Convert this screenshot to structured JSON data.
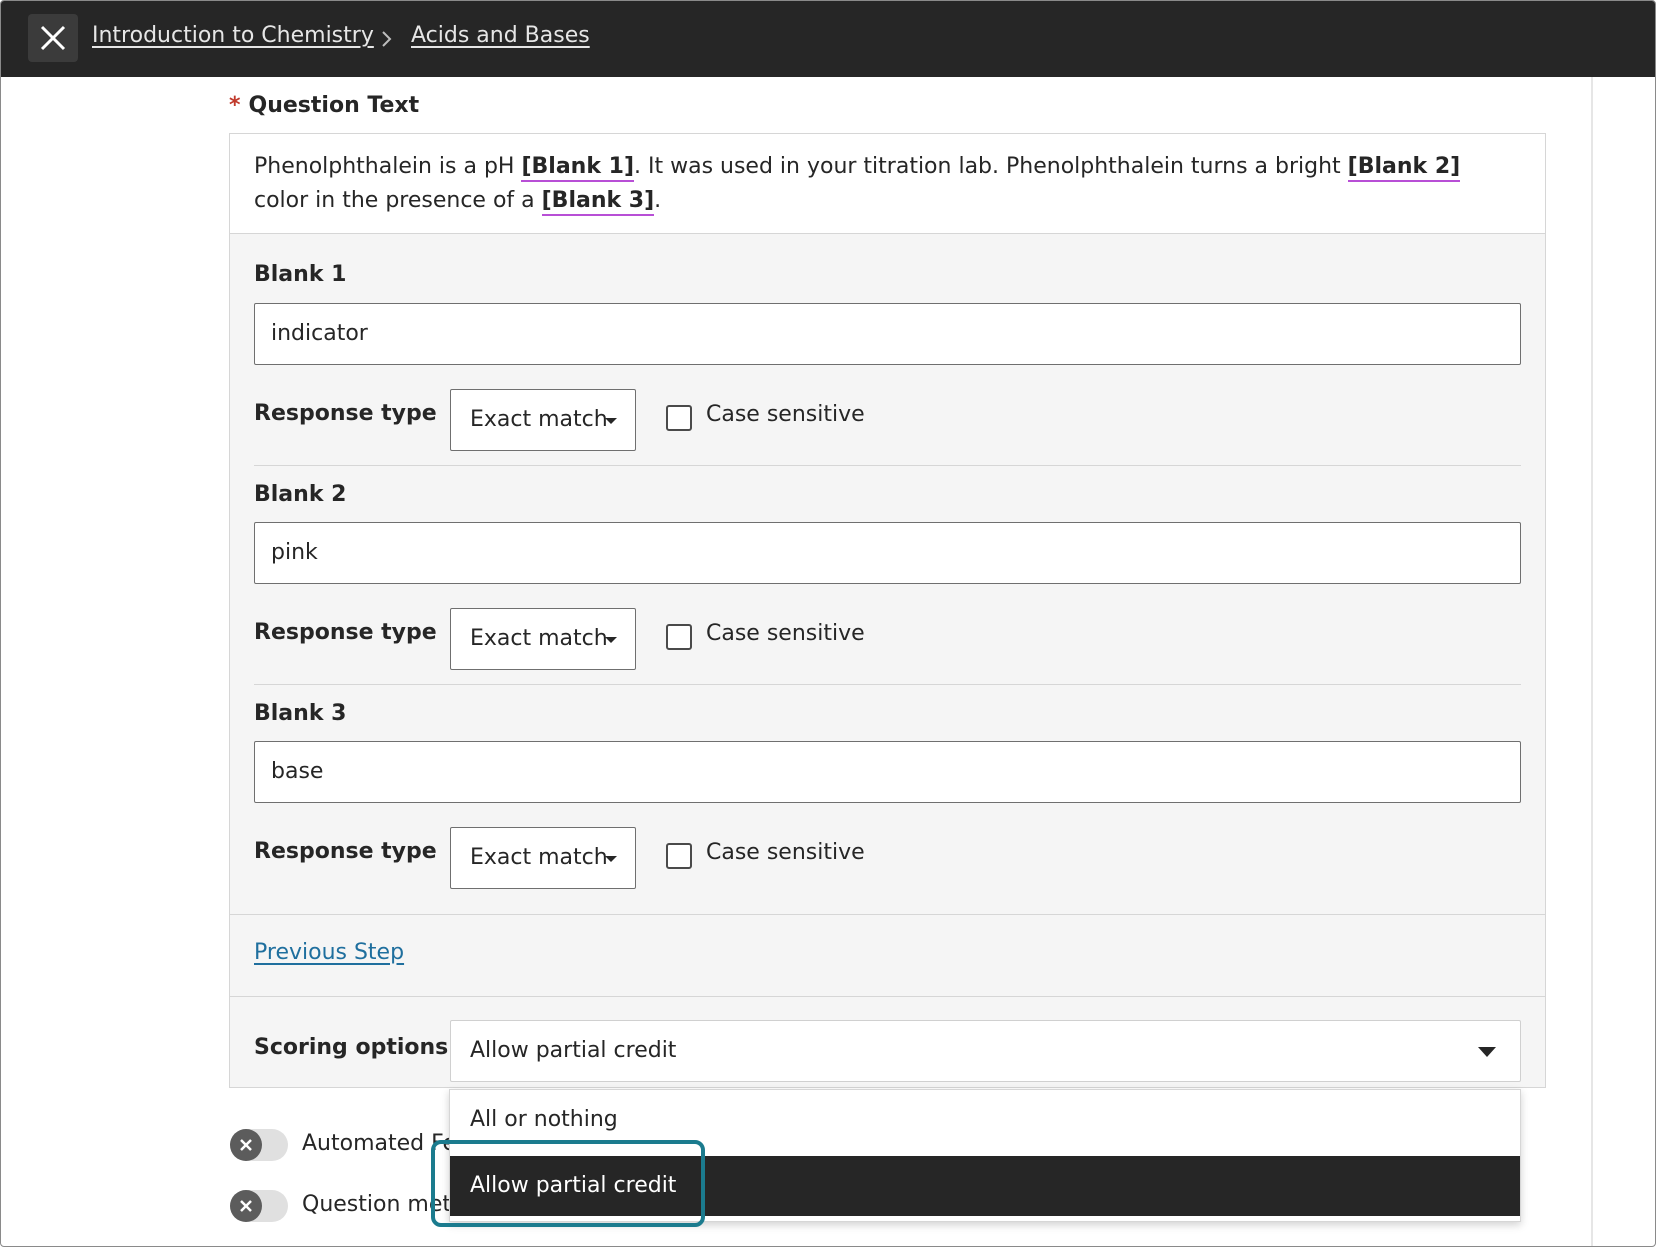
{
  "header": {
    "breadcrumbs": [
      "Introduction to Chemistry",
      "Acids and Bases"
    ]
  },
  "question": {
    "label": "Question Text",
    "required_marker": "*",
    "text_parts": {
      "p1": "Phenolphthalein is a pH ",
      "b1": "[Blank 1]",
      "p2": ". It was used in your titration lab. Phenolphthalein turns a bright ",
      "b2": "[Blank 2]",
      "p3": " color in the presence of a ",
      "b3": "[Blank 3]",
      "p4": "."
    }
  },
  "blanks": [
    {
      "title": "Blank 1",
      "answer": "indicator",
      "response_label": "Response type",
      "response_type": "Exact match",
      "case_label": "Case sensitive",
      "case_checked": false
    },
    {
      "title": "Blank 2",
      "answer": "pink",
      "response_label": "Response type",
      "response_type": "Exact match",
      "case_label": "Case sensitive",
      "case_checked": false
    },
    {
      "title": "Blank 3",
      "answer": "base",
      "response_label": "Response type",
      "response_type": "Exact match",
      "case_label": "Case sensitive",
      "case_checked": false
    }
  ],
  "previous_step": "Previous Step",
  "scoring": {
    "label": "Scoring options",
    "selected": "Allow partial credit",
    "options": [
      "All or nothing",
      "Allow partial credit"
    ]
  },
  "toggles": [
    {
      "label": "Automated Fe",
      "on": false
    },
    {
      "label": "Question meta",
      "on": false
    }
  ],
  "colors": {
    "topbar": "#262626",
    "blank_underline": "#b84fd6",
    "link": "#1f6f9e",
    "focus_ring": "#1b7b8e",
    "required": "#c0392b"
  }
}
